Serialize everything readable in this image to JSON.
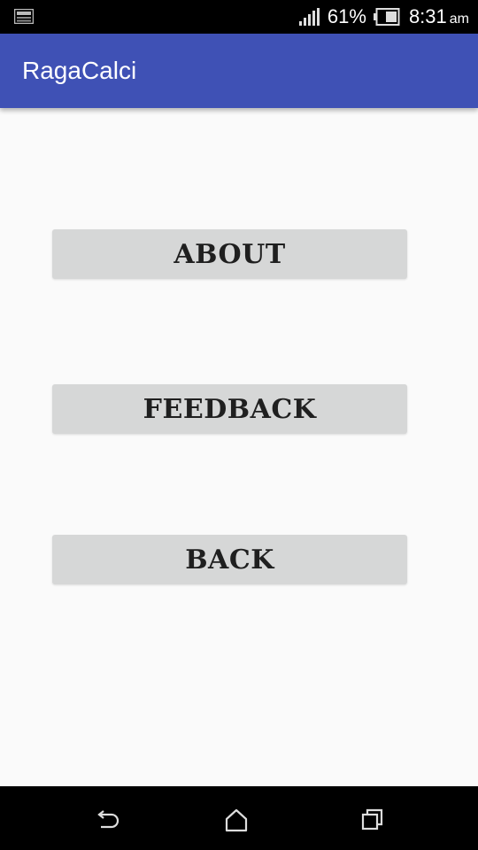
{
  "status_bar": {
    "battery_percent": "61%",
    "time": "8:31",
    "ampm": "am",
    "icons": [
      "notification-icon",
      "signal-icon",
      "battery-icon"
    ]
  },
  "app_bar": {
    "title": "RagaCalci",
    "color": "#3f51b5"
  },
  "main": {
    "buttons": [
      {
        "label": "ABOUT"
      },
      {
        "label": "FEEDBACK"
      },
      {
        "label": "BACK"
      }
    ],
    "button_color": "#d6d7d7"
  },
  "nav_bar": {
    "icons": [
      "back-icon",
      "home-icon",
      "recent-apps-icon"
    ]
  }
}
